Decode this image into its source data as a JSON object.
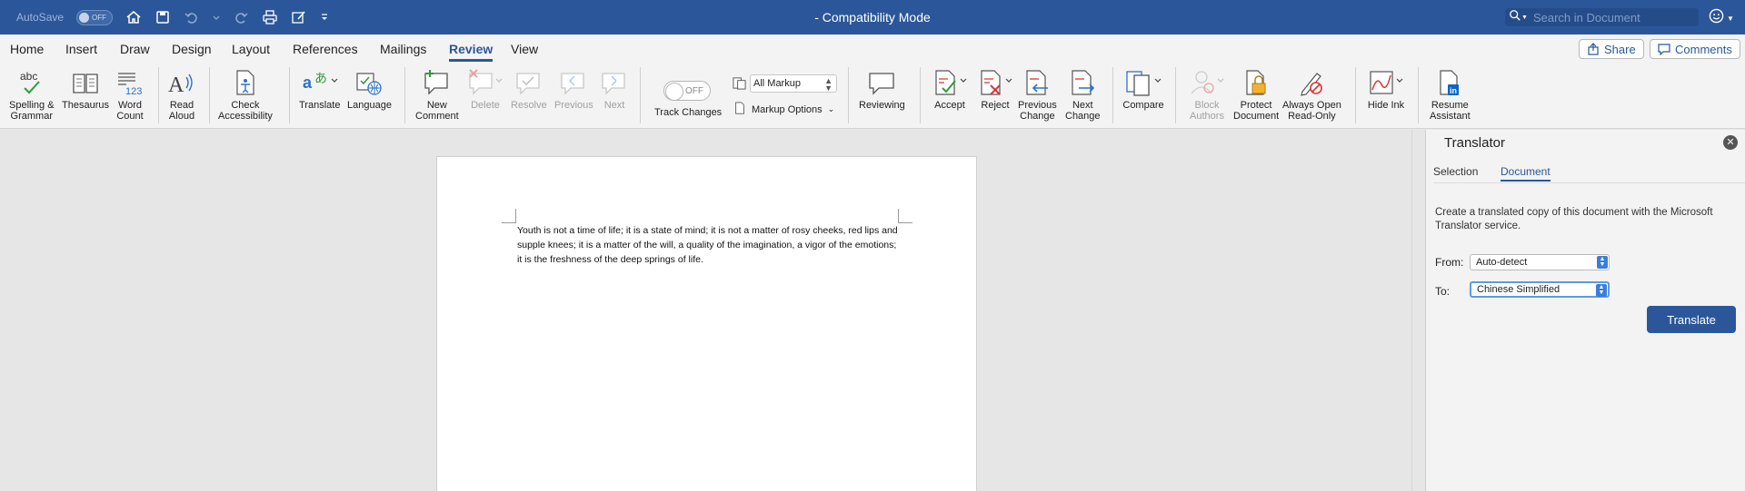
{
  "titlebar": {
    "autosave_label": "AutoSave",
    "autosave_state": "OFF",
    "title": "- Compatibility Mode",
    "search_placeholder": "Search in Document"
  },
  "tabs": [
    "Home",
    "Insert",
    "Draw",
    "Design",
    "Layout",
    "References",
    "Mailings",
    "Review",
    "View"
  ],
  "active_tab": "Review",
  "top_buttons": {
    "share": "Share",
    "comments": "Comments"
  },
  "ribbon": {
    "spelling": [
      "Spelling &",
      "Grammar"
    ],
    "thesaurus": "Thesaurus",
    "word_count": [
      "Word",
      "Count"
    ],
    "read_aloud": [
      "Read",
      "Aloud"
    ],
    "check_accessibility": [
      "Check",
      "Accessibility"
    ],
    "translate": "Translate",
    "language": "Language",
    "new_comment": [
      "New",
      "Comment"
    ],
    "delete": "Delete",
    "resolve": "Resolve",
    "previous": "Previous",
    "next": "Next",
    "track_changes": "Track Changes",
    "track_state": "OFF",
    "markup_value": "All Markup",
    "markup_options": "Markup Options",
    "reviewing": "Reviewing",
    "accept": "Accept",
    "reject": "Reject",
    "previous_change": [
      "Previous",
      "Change"
    ],
    "next_change": [
      "Next",
      "Change"
    ],
    "compare": "Compare",
    "block_authors": [
      "Block",
      "Authors"
    ],
    "protect_document": [
      "Protect",
      "Document"
    ],
    "always_open": [
      "Always Open",
      "Read-Only"
    ],
    "hide_ink": "Hide Ink",
    "resume_assistant": [
      "Resume",
      "Assistant"
    ]
  },
  "document": {
    "text": "Youth is not a time of life; it is a state of mind; it is not a matter of rosy cheeks, red lips and supple knees; it is a matter of the will, a quality of the imagination, a vigor of the emotions; it is the freshness of the deep springs of life."
  },
  "translator": {
    "title": "Translator",
    "tabs": [
      "Selection",
      "Document"
    ],
    "active_tab": "Document",
    "description": "Create a translated copy of this document with the Microsoft Translator service.",
    "from_label": "From:",
    "from_value": "Auto-detect",
    "to_label": "To:",
    "to_value": "Chinese Simplified",
    "translate_button": "Translate"
  },
  "colors": {
    "accent": "#2b579a",
    "ribbon_bg": "#f3f3f3",
    "focus": "#5b9ae8"
  }
}
